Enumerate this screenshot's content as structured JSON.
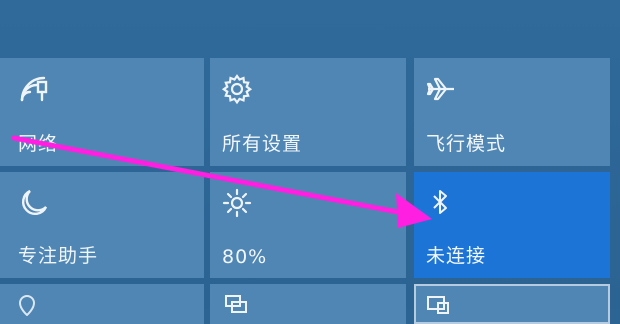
{
  "quick_actions": {
    "tiles": [
      {
        "label": "网络",
        "icon": "wifi-icon"
      },
      {
        "label": "所有设置",
        "icon": "gear-icon"
      },
      {
        "label": "飞行模式",
        "icon": "airplane-icon"
      },
      {
        "label": "专注助手",
        "icon": "moon-icon"
      },
      {
        "label": "80%",
        "icon": "brightness-icon"
      },
      {
        "label": "未连接",
        "icon": "bluetooth-icon",
        "active": true
      }
    ]
  },
  "colors": {
    "background": "#2c6494",
    "tile": "#4f86b3",
    "active_tile": "#1c74d6",
    "annotation_arrow": "#ff1fe0"
  }
}
